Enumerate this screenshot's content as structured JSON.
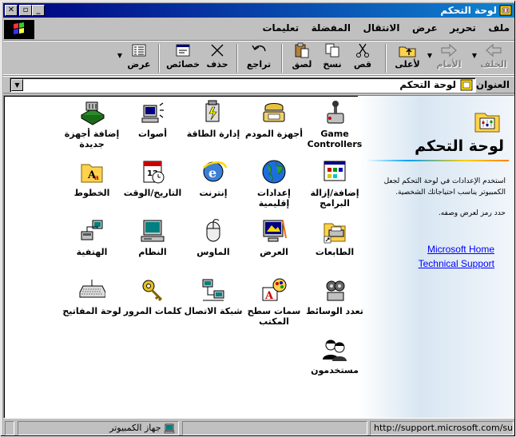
{
  "window": {
    "title": "لوحة التحكم",
    "buttons": {
      "close": "✕",
      "restore": "▫",
      "minimize": "_"
    }
  },
  "menu": [
    "ملف",
    "تحرير",
    "عرض",
    "الانتقال",
    "المفضلة",
    "تعليمات"
  ],
  "toolbar": {
    "back": "الخلف",
    "forward": "الأمام",
    "up": "لأعلى",
    "cut": "قص",
    "copy": "نسخ",
    "paste": "لصق",
    "undo": "تراجع",
    "delete": "حذف",
    "properties": "خصائص",
    "views": "عرض"
  },
  "address": {
    "label": "العنوان",
    "value": "لوحة التحكم"
  },
  "panel": {
    "title": "لوحة التحكم",
    "desc": "استخدم الإعدادات في لوحة التحكم لجعل الكمبيوتر يناسب احتياجاتك الشخصية.",
    "hint": "حدد رمز لعرض وصفه.",
    "link1": "Microsoft Home",
    "link2": "Technical Support"
  },
  "items": [
    {
      "line1": "Game",
      "line2": "Controllers",
      "icon": "game-controllers-icon"
    },
    {
      "line1": "أجهزة المودم",
      "line2": "",
      "icon": "modems-icon"
    },
    {
      "line1": "إدارة الطاقة",
      "line2": "",
      "icon": "power-management-icon"
    },
    {
      "line1": "أصوات",
      "line2": "",
      "icon": "sounds-icon"
    },
    {
      "line1": "إضافة أجهزة",
      "line2": "جديدة",
      "icon": "add-hardware-icon"
    },
    {
      "line1": "إضافة/إزالة",
      "line2": "البرامج",
      "icon": "add-remove-programs-icon"
    },
    {
      "line1": "إعدادات إقليمية",
      "line2": "",
      "icon": "regional-settings-icon"
    },
    {
      "line1": "إنترنت",
      "line2": "",
      "icon": "internet-icon"
    },
    {
      "line1": "التاريخ/الوقت",
      "line2": "",
      "icon": "date-time-icon"
    },
    {
      "line1": "الخطوط",
      "line2": "",
      "icon": "fonts-icon"
    },
    {
      "line1": "الطابعات",
      "line2": "",
      "icon": "printers-icon"
    },
    {
      "line1": "العرض",
      "line2": "",
      "icon": "display-icon"
    },
    {
      "line1": "الماوس",
      "line2": "",
      "icon": "mouse-icon"
    },
    {
      "line1": "النظام",
      "line2": "",
      "icon": "system-icon"
    },
    {
      "line1": "الهتفية",
      "line2": "",
      "icon": "telephony-icon"
    },
    {
      "line1": "تعدد الوسائط",
      "line2": "",
      "icon": "multimedia-icon"
    },
    {
      "line1": "سمات سطح",
      "line2": "المكتب",
      "icon": "desktop-themes-icon"
    },
    {
      "line1": "شبكة الاتصال",
      "line2": "",
      "icon": "network-icon"
    },
    {
      "line1": "كلمات المرور",
      "line2": "",
      "icon": "passwords-icon"
    },
    {
      "line1": "لوحة المفاتيح",
      "line2": "",
      "icon": "keyboard-icon"
    },
    {
      "line1": "مستخدمون",
      "line2": "",
      "icon": "users-icon"
    }
  ],
  "status": {
    "zone": "جهاز الكمبيوتر",
    "url": "http://support.microsoft.com/support"
  }
}
